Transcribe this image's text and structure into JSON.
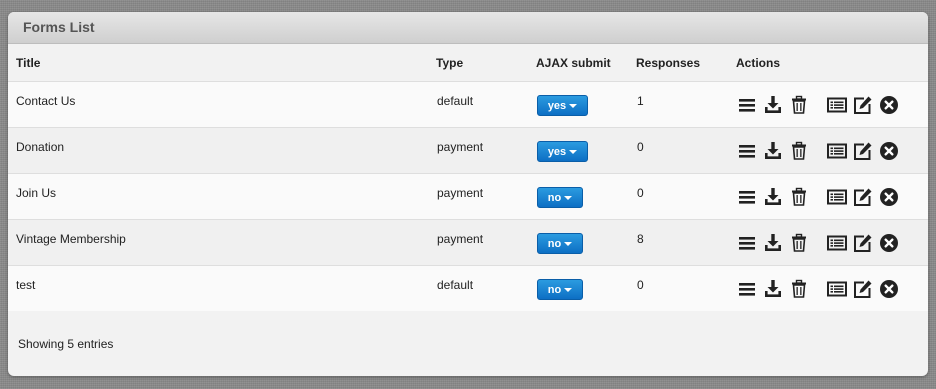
{
  "panel": {
    "title": "Forms List"
  },
  "table": {
    "headers": {
      "title": "Title",
      "type": "Type",
      "ajax": "AJAX submit",
      "responses": "Responses",
      "actions": "Actions"
    },
    "rows": [
      {
        "title": "Contact Us",
        "type": "default",
        "ajax": "yes",
        "responses": "1"
      },
      {
        "title": "Donation",
        "type": "payment",
        "ajax": "yes",
        "responses": "0"
      },
      {
        "title": "Join Us",
        "type": "payment",
        "ajax": "no",
        "responses": "0"
      },
      {
        "title": "Vintage Membership",
        "type": "payment",
        "ajax": "no",
        "responses": "8"
      },
      {
        "title": "test",
        "type": "default",
        "ajax": "no",
        "responses": "0"
      }
    ]
  },
  "footer": {
    "info": "Showing 5 entries"
  },
  "icons": [
    "list-icon",
    "download-icon",
    "trash-icon",
    "view-list-icon",
    "edit-icon",
    "delete-icon"
  ],
  "colors": {
    "button_top": "#2b9be0",
    "button_bottom": "#0d6fc4",
    "icon": "#222222"
  }
}
